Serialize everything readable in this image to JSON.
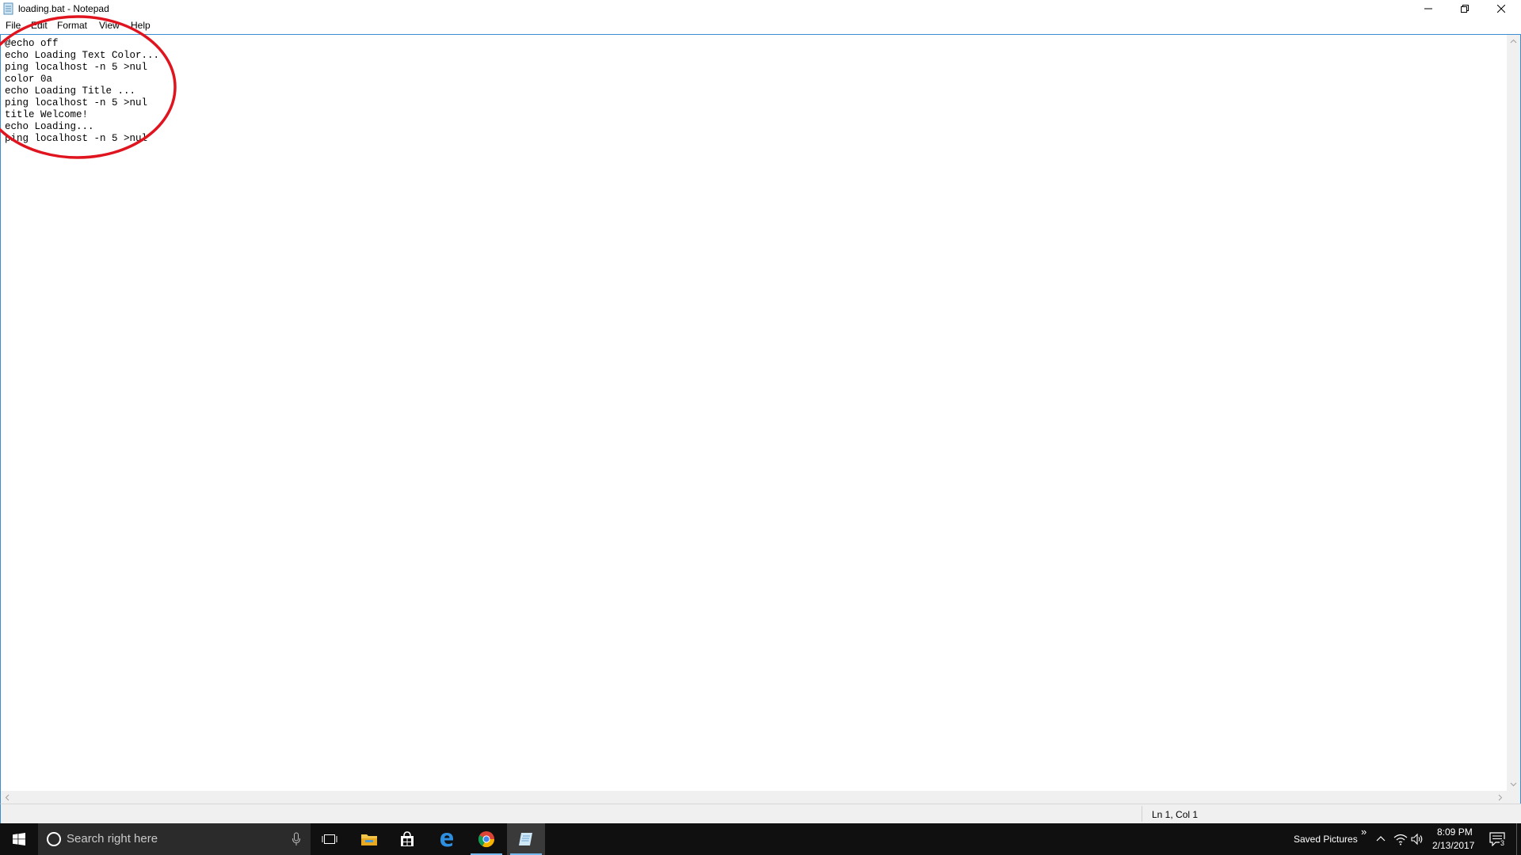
{
  "window": {
    "title": "loading.bat - Notepad"
  },
  "menu": {
    "items": [
      "File",
      "Edit",
      "Format",
      "View",
      "Help"
    ]
  },
  "editor": {
    "content": "@echo off\necho Loading Text Color...\nping localhost -n 5 >nul\ncolor 0a\necho Loading Title ...\nping localhost -n 5 >nul\ntitle Welcome!\necho Loading...\nping localhost -n 5 >nul"
  },
  "status": {
    "position": "Ln 1, Col 1"
  },
  "annotation": {
    "color": "#e0141e"
  },
  "taskbar": {
    "search_placeholder": "Search right here",
    "apps": [
      "start-icon",
      "task-view-icon",
      "file-explorer-icon",
      "store-icon",
      "edge-icon",
      "chrome-icon",
      "notepad-icon"
    ],
    "tray": {
      "toolbar_label": "Saved Pictures",
      "toolbar_overflow": "»",
      "time": "8:09 PM",
      "date": "2/13/2017",
      "notification_count": "3"
    },
    "accent": "#76b9ed"
  }
}
